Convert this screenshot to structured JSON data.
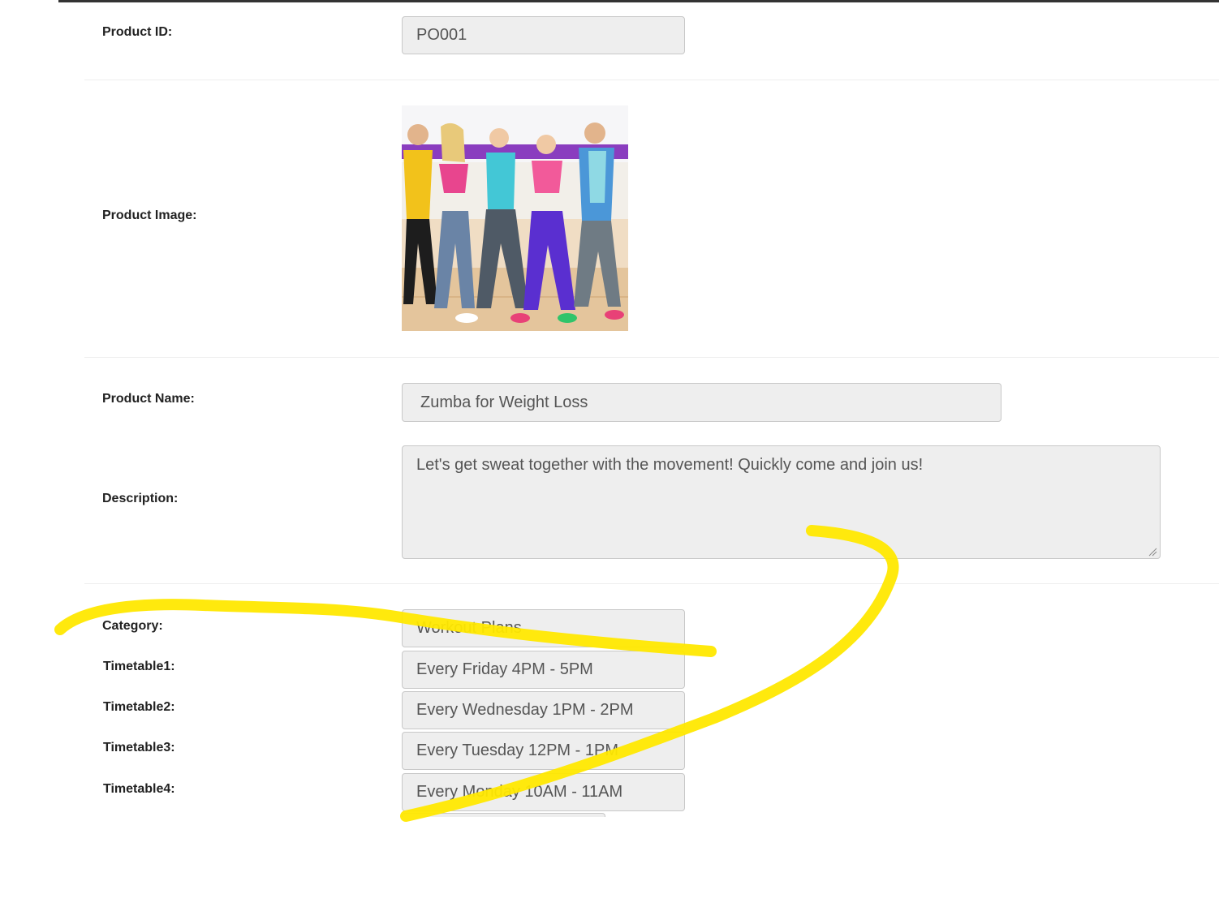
{
  "form": {
    "product_id": {
      "label": "Product ID:",
      "value": "PO001"
    },
    "product_image": {
      "label": "Product Image:"
    },
    "product_name": {
      "label": "Product Name:",
      "value": "Zumba for Weight Loss"
    },
    "description": {
      "label": "Description:",
      "value": "Let's get sweat together with the movement! Quickly come and join us!"
    },
    "category": {
      "label": "Category:",
      "value": "Workout Plans"
    },
    "timetables": [
      {
        "label": "Timetable1:",
        "value": "Every Friday 4PM - 5PM"
      },
      {
        "label": "Timetable2:",
        "value": "Every Wednesday 1PM - 2PM"
      },
      {
        "label": "Timetable3:",
        "value": "Every Tuesday 12PM - 1PM"
      },
      {
        "label": "Timetable4:",
        "value": "Every Monday 10AM - 11AM"
      }
    ]
  },
  "colors": {
    "field_bg": "#eeeeee",
    "field_border": "#c8c8c8",
    "label_text": "#222222",
    "value_text": "#555555",
    "annotation_stroke": "#ffe800"
  }
}
